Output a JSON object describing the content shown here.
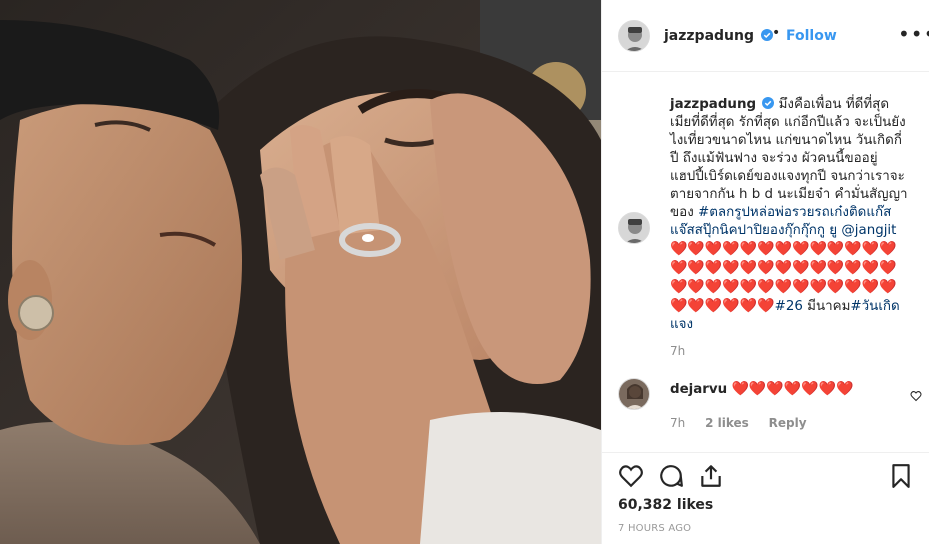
{
  "post": {
    "username": "jazzpadung",
    "dot": "•",
    "follow_label": "Follow",
    "more_label": "•••"
  },
  "caption": {
    "username": "jazzpadung",
    "text_1": "มึงคือเพื่อน ที่ดีที่สุด เมียที่ดีที่สุด รักที่สุด แก่อีกปีแล้ว จะเป็นยังไงเที่ยวขนาดไหน แก่ขนาดไหน วันเกิดกี่ปี ถึงแม้ฟันฟาง จะร่วง ผัวคนนี้ขออยู่ แฮปปี้เบิร์ดเดย์ของแจงทุกปี จนกว่าเราจะตายจากกัน h b d นะเมียจ๋า คำมั่นสัญญา ของ",
    "hashtag_1": "#ตลกรูปหล่อพ่อรวยรถเก๋งติดแก๊สแจ๊สสปุ๊กนิคปาปิยองกุ๊กกุ๊กกู ยู",
    "mention": "@jangjit",
    "hearts": "❤️❤️❤️❤️❤️❤️❤️❤️❤️❤️❤️❤️❤️❤️❤️❤️❤️❤️❤️❤️❤️❤️❤️❤️❤️❤️❤️❤️❤️❤️❤️❤️❤️❤️❤️❤️❤️❤️❤️❤️❤️❤️❤️❤️❤️",
    "hashtag_2": "#26",
    "text_2": "มีนาคม",
    "hashtag_3": "#วันเกิดแจง",
    "time": "7h"
  },
  "comment": {
    "username": "dejarvu",
    "text": "❤️❤️❤️❤️❤️❤️❤️",
    "time": "7h",
    "likes": "2 likes",
    "reply": "Reply"
  },
  "actions": {
    "likes": "60,382 likes",
    "post_time": "7 HOURS AGO"
  },
  "colors": {
    "link": "#3897f0",
    "hashtag": "#003569",
    "heart": "#ed2d2d",
    "muted": "#8e8e8e"
  },
  "icons": [
    "verified-icon",
    "more-icon",
    "heart-icon",
    "comment-icon",
    "share-icon",
    "bookmark-icon"
  ]
}
